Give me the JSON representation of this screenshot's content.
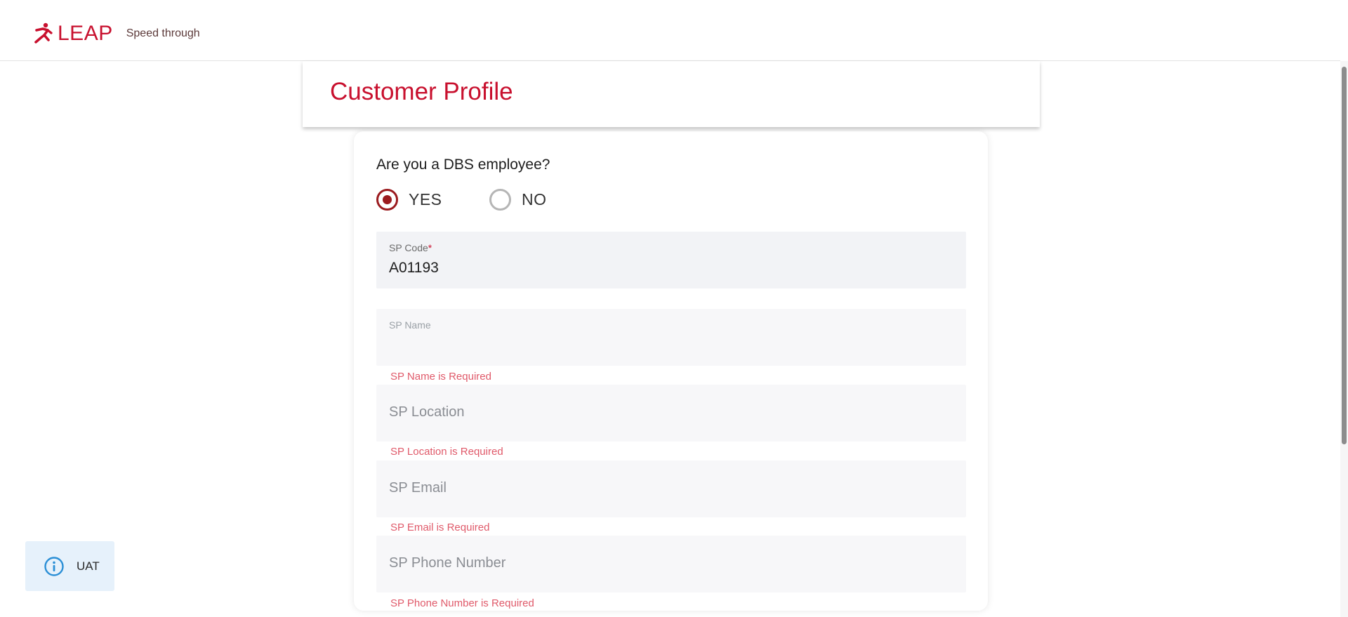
{
  "header": {
    "brand": "LEAP",
    "tagline": "Speed through",
    "brand_color": "#c8102e"
  },
  "page": {
    "title": "Customer Profile"
  },
  "form": {
    "question": "Are you a DBS employee?",
    "options": [
      {
        "label": "YES",
        "selected": true
      },
      {
        "label": "NO",
        "selected": false
      }
    ],
    "sp_code": {
      "label": "SP Code",
      "required_mark": "*",
      "value": "A01193"
    },
    "sp_name": {
      "label": "SP Name",
      "error": "SP Name is Required"
    },
    "sp_location": {
      "placeholder": "SP Location",
      "error": "SP Location is Required"
    },
    "sp_email": {
      "placeholder": "SP Email",
      "error": "SP Email is Required"
    },
    "sp_phone": {
      "placeholder": "SP Phone Number",
      "error": "SP Phone Number is Required"
    }
  },
  "env_badge": {
    "label": "UAT",
    "icon": "info-icon"
  },
  "colors": {
    "accent": "#c8102e",
    "radio_checked": "#9b1b1f",
    "error": "#e05a6a",
    "badge_bg": "#e6f1fb",
    "info_icon": "#2b8fd6"
  }
}
